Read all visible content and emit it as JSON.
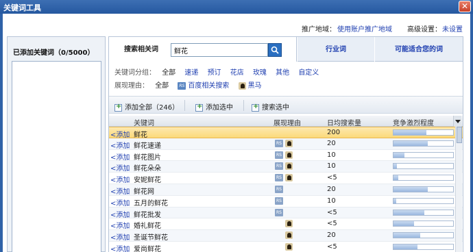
{
  "window": {
    "title": "关键词工具",
    "close_icon": "close-icon"
  },
  "topbar": {
    "region_label": "推广地域：",
    "region_value": "使用账户推广地域",
    "advanced_label": "高级设置：",
    "advanced_value": "未设置"
  },
  "left": {
    "added_title": "已添加关键词（0/5000）"
  },
  "tabs": {
    "search_label": "搜索相关词",
    "search_value": "鲜花",
    "industry_label": "行业词",
    "suggest_label": "可能适合您的词"
  },
  "filters": {
    "group_label": "关键词分组：",
    "group_items": [
      "全部",
      "速递",
      "预订",
      "花店",
      "玫瑰",
      "其他",
      "自定义"
    ],
    "reason_label": "展现理由：",
    "reason_items": [
      "全部",
      "百度相关搜索",
      "黑马"
    ]
  },
  "actions": {
    "add_all": "添加全部（246）",
    "add_selected": "添加选中",
    "search_selected": "搜索选中"
  },
  "grid": {
    "columns": [
      "关键词",
      "展现理由",
      "日均搜索量",
      "竞争激烈程度"
    ],
    "add_label": "<添加",
    "rows": [
      {
        "keyword": "鲜花",
        "rs": false,
        "horse": false,
        "volume": "200",
        "competition": 0.55
      },
      {
        "keyword": "鲜花速递",
        "rs": true,
        "horse": true,
        "volume": "20",
        "competition": 0.58
      },
      {
        "keyword": "鲜花图片",
        "rs": true,
        "horse": true,
        "volume": "10",
        "competition": 0.18
      },
      {
        "keyword": "鲜花朵朵",
        "rs": true,
        "horse": true,
        "volume": "10",
        "competition": 0.06
      },
      {
        "keyword": "安妮鲜花",
        "rs": true,
        "horse": true,
        "volume": "<5",
        "competition": 0.08
      },
      {
        "keyword": "鲜花网",
        "rs": true,
        "horse": false,
        "volume": "20",
        "competition": 0.58
      },
      {
        "keyword": "五月的鲜花",
        "rs": true,
        "horse": false,
        "volume": "10",
        "competition": 0.05
      },
      {
        "keyword": "鲜花批发",
        "rs": true,
        "horse": false,
        "volume": "<5",
        "competition": 0.52
      },
      {
        "keyword": "婚礼鲜花",
        "rs": false,
        "horse": true,
        "volume": "<5",
        "competition": 0.34
      },
      {
        "keyword": "圣诞节鲜花",
        "rs": false,
        "horse": true,
        "volume": "20",
        "competition": 0.45
      },
      {
        "keyword": "爱尚鲜花",
        "rs": false,
        "horse": true,
        "volume": "<5",
        "competition": 0.4
      }
    ]
  }
}
